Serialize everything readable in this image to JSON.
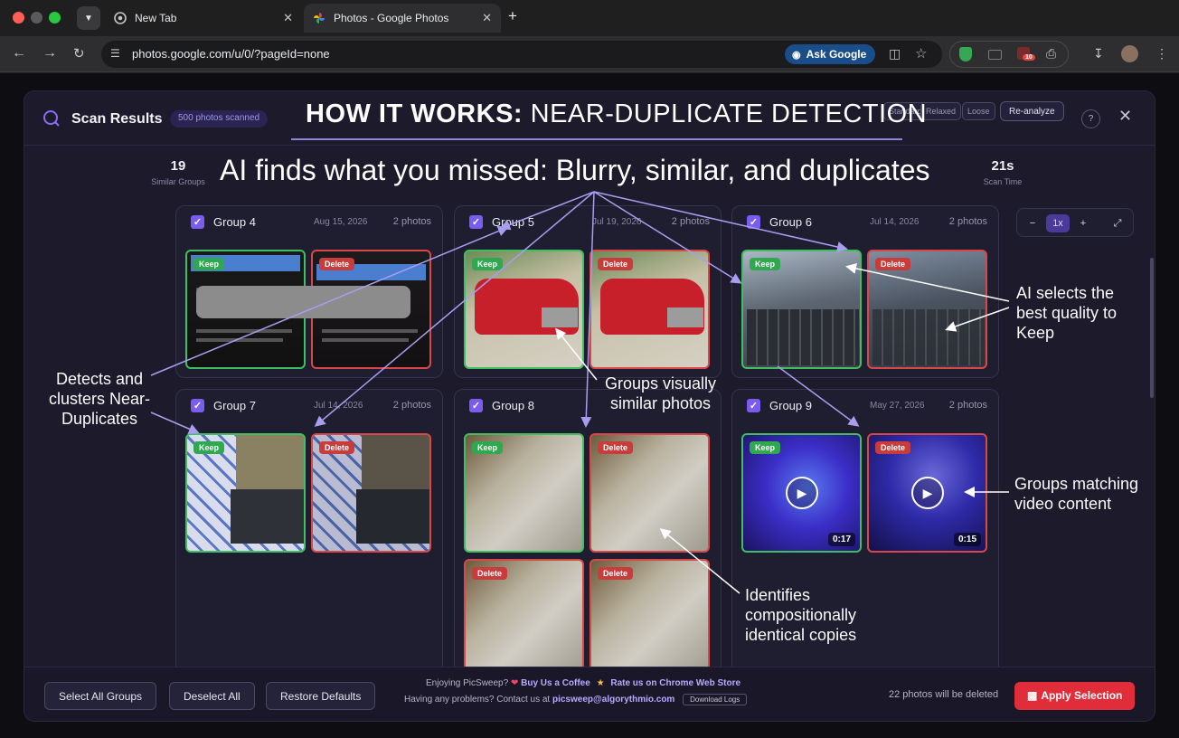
{
  "browser": {
    "tabs": [
      {
        "title": "New Tab",
        "icon": "chrome-icon",
        "active": false
      },
      {
        "title": "Photos - Google Photos",
        "icon": "google-photos-icon",
        "active": true
      }
    ],
    "url": "photos.google.com/u/0/?pageId=none",
    "ask_google": "Ask Google",
    "extension_badge": "10"
  },
  "modal": {
    "title": "Scan Results",
    "badge": "500 photos scanned",
    "sensitivity": [
      "Standard",
      "Relaxed",
      "Loose"
    ],
    "reanalyze": "Re-analyze",
    "help": "?",
    "stats": [
      {
        "value": "19",
        "label": "Similar Groups"
      },
      {
        "value": "21s",
        "label": "Scan Time"
      }
    ],
    "groups": [
      {
        "title": "Group 4",
        "date": "Aug 15, 2026",
        "count": "2 photos",
        "photos": [
          {
            "tag": "Keep"
          },
          {
            "tag": "Delete"
          }
        ]
      },
      {
        "title": "Group 5",
        "date": "Jul 19, 2026",
        "count": "2 photos",
        "photos": [
          {
            "tag": "Keep"
          },
          {
            "tag": "Delete"
          }
        ]
      },
      {
        "title": "Group 6",
        "date": "Jul 14, 2026",
        "count": "2 photos",
        "photos": [
          {
            "tag": "Keep"
          },
          {
            "tag": "Delete"
          }
        ]
      },
      {
        "title": "Group 7",
        "date": "Jul 14, 2026",
        "count": "2 photos",
        "photos": [
          {
            "tag": "Keep"
          },
          {
            "tag": "Delete"
          }
        ]
      },
      {
        "title": "Group 8",
        "date": "",
        "count": "",
        "photos": [
          {
            "tag": "Keep"
          },
          {
            "tag": "Delete"
          },
          {
            "tag": "Delete"
          },
          {
            "tag": "Delete"
          }
        ]
      },
      {
        "title": "Group 9",
        "date": "May 27, 2026",
        "count": "2 photos",
        "photos": [
          {
            "tag": "Keep",
            "duration": "0:17"
          },
          {
            "tag": "Delete",
            "duration": "0:15"
          }
        ]
      }
    ],
    "zoom": {
      "minus": "−",
      "level": "1x",
      "plus": "+"
    },
    "footer": {
      "select_all": "Select All Groups",
      "deselect_all": "Deselect All",
      "restore": "Restore Defaults",
      "enjoying": "Enjoying PicSweep?",
      "coffee": "Buy Us a Coffee",
      "rate": "Rate us on Chrome Web Store",
      "problems": "Having any problems? Contact us at",
      "email": "picsweep@algorythmio.com",
      "download_logs": "Download Logs",
      "will_delete": "22 photos will be deleted",
      "apply": "Apply Selection"
    }
  },
  "overlay": {
    "title_bold": "HOW IT WORKS:",
    "title_rest": " NEAR-DUPLICATE DETECTION",
    "subtitle": "AI finds what you missed: Blurry, similar, and duplicates",
    "annotations": {
      "detects": "Detects and clusters Near-Duplicates",
      "groups_visually": "Groups visually similar photos",
      "ai_selects": "AI selects the best quality to Keep",
      "identifies": "Identifies compositionally identical copies",
      "video": "Groups matching video content"
    }
  },
  "colors": {
    "accent": "#7a5cf0",
    "keep": "#3fbf5f",
    "delete": "#d94848",
    "apply": "#e12d3a"
  }
}
